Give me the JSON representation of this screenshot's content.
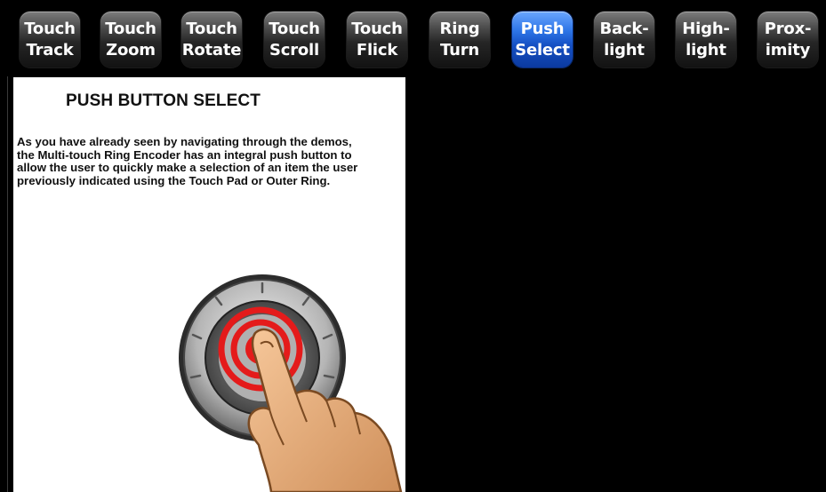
{
  "tabs": [
    {
      "label": "Touch\nTrack",
      "active": false
    },
    {
      "label": "Touch\nZoom",
      "active": false
    },
    {
      "label": "Touch\nRotate",
      "active": false
    },
    {
      "label": "Touch\nScroll",
      "active": false
    },
    {
      "label": "Touch\nFlick",
      "active": false
    },
    {
      "label": "Ring\nTurn",
      "active": false
    },
    {
      "label": "Push\nSelect",
      "active": true
    },
    {
      "label": "Back-\nlight",
      "active": false
    },
    {
      "label": "High-\nlight",
      "active": false
    },
    {
      "label": "Prox-\nimity",
      "active": false
    }
  ],
  "panel": {
    "title": "PUSH BUTTON SELECT",
    "body": "As you have already seen by navigating through the demos, the Multi-touch Ring Encoder has an integral push button to allow the user to quickly make a selection of an item the user previously indicated using the Touch Pad or Outer Ring."
  },
  "colors": {
    "active_tab": "#1f5fd6",
    "inactive_tab": "#3a3a3a",
    "button_red": "#e41b1b",
    "background": "#000000",
    "panel": "#ffffff"
  },
  "icons": {
    "illustration": "finger-pressing-ring-encoder-button"
  }
}
